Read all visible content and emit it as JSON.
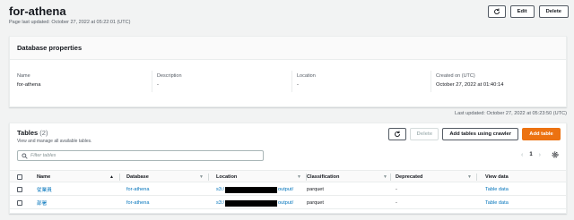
{
  "header": {
    "title": "for-athena",
    "subtitle": "Page last updated: October 27, 2022 at 05:22:01 (UTC)",
    "refresh_icon": "refresh-icon",
    "edit_label": "Edit",
    "delete_label": "Delete"
  },
  "properties": {
    "title": "Database properties",
    "fields": [
      {
        "label": "Name",
        "value": "for-athena"
      },
      {
        "label": "Description",
        "value": "-"
      },
      {
        "label": "Location",
        "value": "-"
      },
      {
        "label": "Created on (UTC)",
        "value": "October 27, 2022 at 01:40:14"
      }
    ]
  },
  "last_updated": "Last updated: October 27, 2022 at 05:23:50 (UTC)",
  "tables": {
    "title": "Tables",
    "count": "(2)",
    "subtitle": "View and manage all available tables.",
    "delete_label": "Delete",
    "add_crawler_label": "Add tables using crawler",
    "add_table_label": "Add table",
    "search_placeholder": "Filter tables",
    "page": "1",
    "columns": [
      "Name",
      "Database",
      "Location",
      "Classification",
      "Deprecated",
      "View data"
    ],
    "rows": [
      {
        "name": "従業員",
        "database": "for-athena",
        "location_prefix": "s3:/",
        "location_suffix": "output/",
        "classification": "parquet",
        "deprecated": "-",
        "view": "Table data"
      },
      {
        "name": "部署",
        "database": "for-athena",
        "location_prefix": "s3:/",
        "location_suffix": "output/",
        "classification": "parquet",
        "deprecated": "-",
        "view": "Table data"
      }
    ]
  },
  "colors": {
    "accent": "#ec7211",
    "link": "#0073bb"
  }
}
